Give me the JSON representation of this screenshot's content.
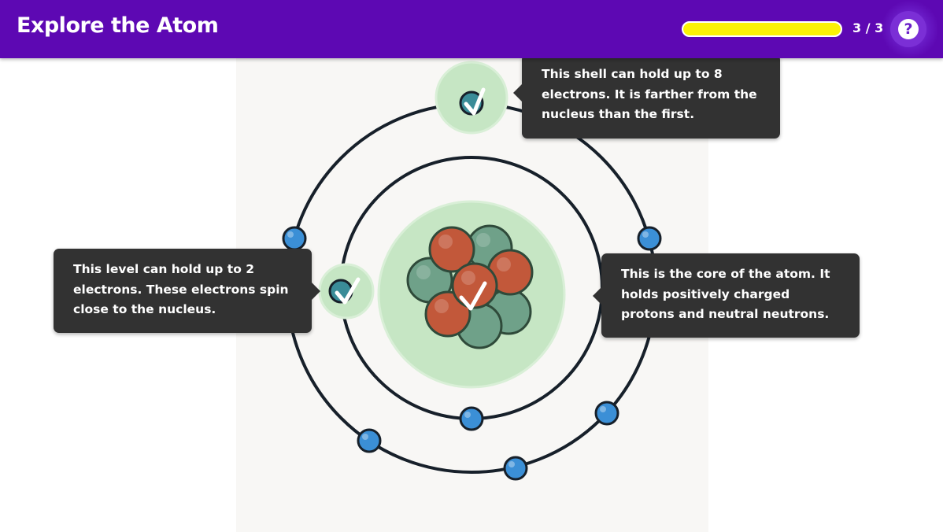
{
  "header": {
    "title": "Explore the Atom",
    "progress_fraction": 1.0,
    "progress_text": "3 / 3",
    "help_label": "?"
  },
  "tooltips": {
    "outer_shell": "This shell can hold up to 8 electrons. It is farther from the nucleus than the first.",
    "inner_level": "This level can hold up to 2 electrons. These electrons spin close to the nucleus.",
    "nucleus": "This is the core of the atom. It holds positively charged protons and neutral neutrons."
  },
  "colors": {
    "header_bg": "#5d08b3",
    "progress_fill": "#fbf205",
    "orbit": "#17202a",
    "electron": "#3b8fd6",
    "proton": "#c2583a",
    "neutron": "#6fa189",
    "highlight": "#c6e6c4",
    "tooltip_bg": "#323232"
  },
  "icons": {
    "check": "check-icon",
    "help": "question-icon"
  }
}
